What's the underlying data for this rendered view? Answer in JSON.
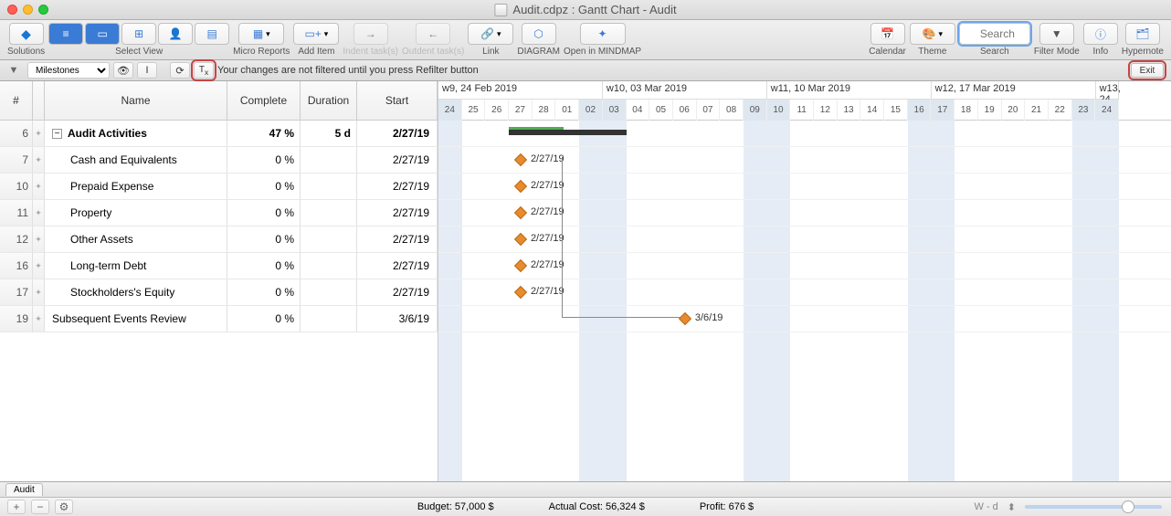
{
  "window": {
    "title": "Audit.cdpz : Gantt Chart - Audit"
  },
  "toolbar": {
    "solutions": "Solutions",
    "select_view": "Select View",
    "micro_reports": "Micro Reports",
    "add_item": "Add Item",
    "indent": "Indent task(s)",
    "outdent": "Outdent task(s)",
    "link": "Link",
    "diagram": "DIAGRAM",
    "mindmap": "Open in MINDMAP",
    "calendar": "Calendar",
    "theme": "Theme",
    "search_placeholder": "Search",
    "search_label": "Search",
    "filter_mode": "Filter Mode",
    "info": "Info",
    "hypernote": "Hypernote"
  },
  "filterbar": {
    "select_value": "Milestones",
    "message": "Your changes are not filtered until you press Refilter button",
    "exit": "Exit"
  },
  "columns": {
    "idx": "#",
    "name": "Name",
    "complete": "Complete",
    "duration": "Duration",
    "start": "Start"
  },
  "rows": [
    {
      "num": "6",
      "name": "Audit Activities",
      "complete": "47 %",
      "duration": "5 d",
      "start": "2/27/19",
      "bold": true,
      "indent": false,
      "expand": true
    },
    {
      "num": "7",
      "name": "Cash and Equivalents",
      "complete": "0 %",
      "duration": "",
      "start": "2/27/19",
      "bold": false,
      "indent": true
    },
    {
      "num": "10",
      "name": "Prepaid Expense",
      "complete": "0 %",
      "duration": "",
      "start": "2/27/19",
      "bold": false,
      "indent": true
    },
    {
      "num": "11",
      "name": "Property",
      "complete": "0 %",
      "duration": "",
      "start": "2/27/19",
      "bold": false,
      "indent": true
    },
    {
      "num": "12",
      "name": "Other Assets",
      "complete": "0 %",
      "duration": "",
      "start": "2/27/19",
      "bold": false,
      "indent": true
    },
    {
      "num": "16",
      "name": "Long-term Debt",
      "complete": "0 %",
      "duration": "",
      "start": "2/27/19",
      "bold": false,
      "indent": true
    },
    {
      "num": "17",
      "name": "Stockholders's Equity",
      "complete": "0 %",
      "duration": "",
      "start": "2/27/19",
      "bold": false,
      "indent": true
    },
    {
      "num": "19",
      "name": "Subsequent Events Review",
      "complete": "0 %",
      "duration": "",
      "start": "3/6/19",
      "bold": false,
      "indent": false
    }
  ],
  "weeks": [
    {
      "label": "w9, 24 Feb 2019",
      "days": [
        "24",
        "25",
        "26",
        "27",
        "28",
        "01",
        "02"
      ]
    },
    {
      "label": "w10, 03 Mar 2019",
      "days": [
        "03",
        "04",
        "05",
        "06",
        "07",
        "08",
        "09"
      ]
    },
    {
      "label": "w11, 10 Mar 2019",
      "days": [
        "10",
        "11",
        "12",
        "13",
        "14",
        "15",
        "16"
      ]
    },
    {
      "label": "w12, 17 Mar 2019",
      "days": [
        "17",
        "18",
        "19",
        "20",
        "21",
        "22",
        "23"
      ]
    },
    {
      "label": "w13, 24",
      "days": [
        "24"
      ]
    }
  ],
  "gantt": {
    "milestone_label_227": "2/27/19",
    "milestone_label_36": "3/6/19"
  },
  "tab": "Audit",
  "status": {
    "budget": "Budget: 57,000 $",
    "actual": "Actual Cost: 56,324 $",
    "profit": "Profit: 676 $",
    "zoom_label": "W - d"
  },
  "chart_data": {
    "type": "gantt",
    "time_unit": "day",
    "timeline_start": "2019-02-24",
    "tasks": [
      {
        "id": 6,
        "name": "Audit Activities",
        "type": "summary",
        "start": "2019-02-27",
        "duration_days": 5,
        "percent_complete": 47
      },
      {
        "id": 7,
        "name": "Cash and Equivalents",
        "type": "milestone",
        "date": "2019-02-27",
        "label": "2/27/19"
      },
      {
        "id": 10,
        "name": "Prepaid Expense",
        "type": "milestone",
        "date": "2019-02-27",
        "label": "2/27/19"
      },
      {
        "id": 11,
        "name": "Property",
        "type": "milestone",
        "date": "2019-02-27",
        "label": "2/27/19"
      },
      {
        "id": 12,
        "name": "Other Assets",
        "type": "milestone",
        "date": "2019-02-27",
        "label": "2/27/19"
      },
      {
        "id": 16,
        "name": "Long-term Debt",
        "type": "milestone",
        "date": "2019-02-27",
        "label": "2/27/19"
      },
      {
        "id": 17,
        "name": "Stockholders's Equity",
        "type": "milestone",
        "date": "2019-02-27",
        "label": "2/27/19"
      },
      {
        "id": 19,
        "name": "Subsequent Events Review",
        "type": "milestone",
        "date": "2019-03-06",
        "label": "3/6/19"
      }
    ],
    "dependencies": [
      {
        "from": 7,
        "to": 19
      },
      {
        "from": 10,
        "to": 19
      },
      {
        "from": 11,
        "to": 19
      },
      {
        "from": 12,
        "to": 19
      },
      {
        "from": 16,
        "to": 19
      },
      {
        "from": 17,
        "to": 19
      }
    ]
  }
}
